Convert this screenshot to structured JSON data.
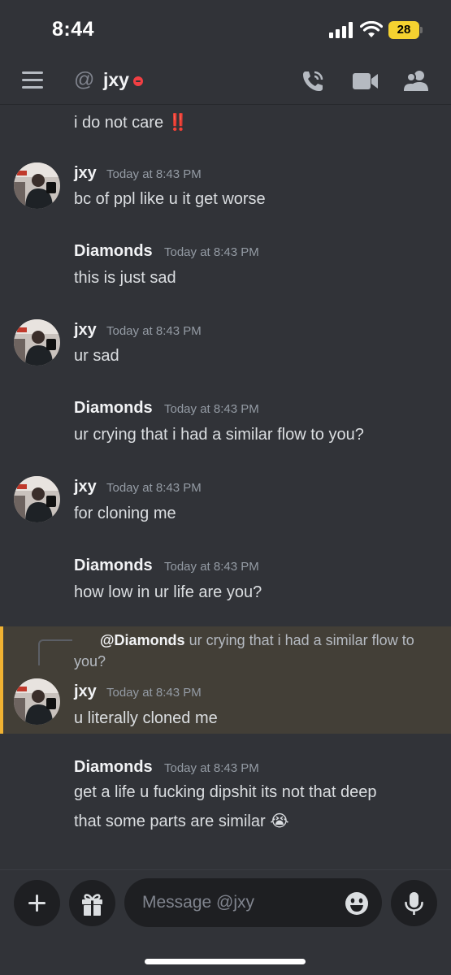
{
  "status_bar": {
    "time": "8:44",
    "battery": "28"
  },
  "header": {
    "at_symbol": "@",
    "channel_name": "jxy"
  },
  "messages": [
    {
      "author": "",
      "time": "",
      "lines": [
        "i do not care ‼️"
      ]
    },
    {
      "author": "jxy",
      "time": "Today at 8:43 PM",
      "lines": [
        "bc of ppl like u it get worse"
      ]
    },
    {
      "author": "Diamonds",
      "time": "Today at 8:43 PM",
      "lines": [
        "this is just sad"
      ]
    },
    {
      "author": "jxy",
      "time": "Today at 8:43 PM",
      "lines": [
        "ur sad"
      ]
    },
    {
      "author": "Diamonds",
      "time": "Today at 8:43 PM",
      "lines": [
        "ur crying that i had a similar flow to you?"
      ]
    },
    {
      "author": "jxy",
      "time": "Today at 8:43 PM",
      "lines": [
        "for cloning me"
      ]
    },
    {
      "author": "Diamonds",
      "time": "Today at 8:43 PM",
      "lines": [
        "how low in ur life are you?"
      ]
    },
    {
      "author": "jxy",
      "time": "Today at 8:43 PM",
      "lines": [
        "u literally cloned me"
      ],
      "reply": {
        "mention": "@Diamonds",
        "text": "ur crying that i had a similar flow to you?"
      }
    },
    {
      "author": "Diamonds",
      "time": "Today at 8:43 PM",
      "lines": [
        "get a life u fucking dipshit its not that deep",
        "that some parts are similar 😭"
      ]
    }
  ],
  "composer": {
    "placeholder": "Message @jxy"
  },
  "colors": {
    "background": "#313338",
    "reply_highlight": "#433f37",
    "reply_bar": "#f0b232",
    "dnd": "#f23f43"
  }
}
